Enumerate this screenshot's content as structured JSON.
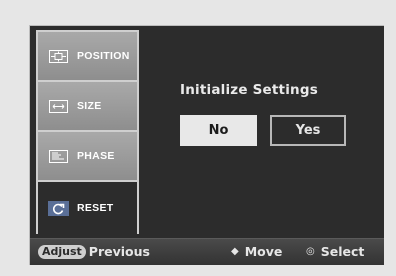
{
  "sidebar": {
    "items": [
      {
        "label": "POSITION",
        "icon": "position-icon"
      },
      {
        "label": "SIZE",
        "icon": "size-icon"
      },
      {
        "label": "PHASE",
        "icon": "phase-icon"
      },
      {
        "label": "RESET",
        "icon": "reset-icon",
        "active": true
      }
    ]
  },
  "dialog": {
    "title": "Initialize Settings",
    "no_label": "No",
    "yes_label": "Yes"
  },
  "statusbar": {
    "adjust_badge": "Adjust",
    "previous_label": "Previous",
    "move_glyph": "◆",
    "move_label": "Move",
    "select_glyph": "◎",
    "select_label": "Select"
  },
  "colors": {
    "panel_bg": "#2c2c2c",
    "active_icon_bg": "#5a6f97",
    "selected_button": "#e8e8e8"
  }
}
